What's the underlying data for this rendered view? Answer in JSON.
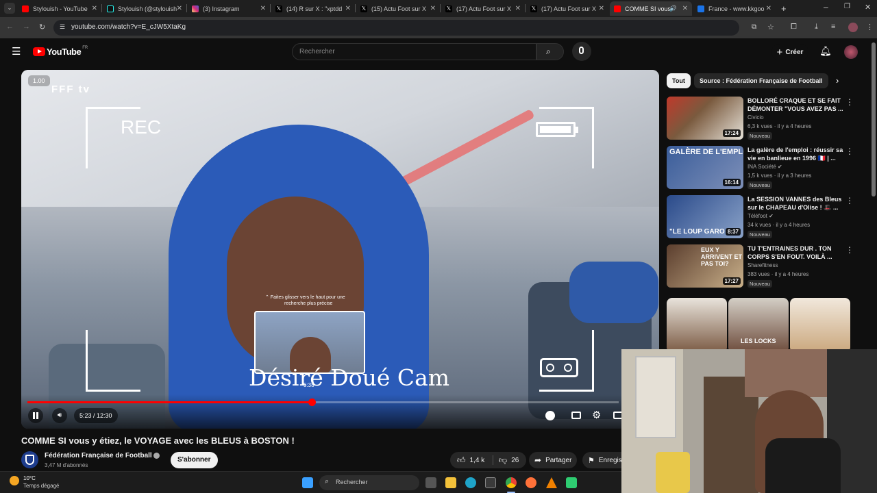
{
  "browser": {
    "tabs": [
      {
        "title": "Stylouish - YouTube",
        "color": "#ff0000"
      },
      {
        "title": "Stylouish (@stylouish",
        "color": "#111111"
      },
      {
        "title": "(3) Instagram",
        "color": "#d62976"
      },
      {
        "title": "(14) R sur X : \"xptdd",
        "color": "#000000"
      },
      {
        "title": "(15) Actu Foot sur X",
        "color": "#000000"
      },
      {
        "title": "(17) Actu Foot sur X",
        "color": "#000000"
      },
      {
        "title": "(17) Actu Foot sur X",
        "color": "#000000"
      },
      {
        "title": "COMME SI vous",
        "color": "#ff0000",
        "active": true
      },
      {
        "title": "France - www.kkgoo",
        "color": "#1a73e8"
      }
    ],
    "new_tab": "+",
    "url": "youtube.com/watch?v=E_cJW5XtaKg"
  },
  "youtube": {
    "logo_text": "YouTube",
    "region": "FR",
    "search_placeholder": "Rechercher",
    "create_label": "Créer"
  },
  "player": {
    "speed_badge": "1.00",
    "watermark": "FFF tv",
    "rec_label": "REC",
    "overlay_title": "Désiré Doué Cam",
    "hint_line1": "⌃ Faites glisser vers le haut pour une",
    "hint_line2": "recherche plus précise",
    "preview_time": "5:38",
    "time_current": "5:23",
    "time_total": "12:30",
    "time_display": "5:23 / 12:30",
    "progress": 0.4813
  },
  "video": {
    "title": "COMME SI vous y étiez, le VOYAGE avec les BLEUS à BOSTON !",
    "channel": "Fédération Française de Football",
    "subscribers": "3,47 M d'abonnés",
    "subscribe_label": "S'abonner",
    "likes": "1,4 k",
    "dislikes": "26",
    "share_label": "Partager",
    "save_label": "Enregis"
  },
  "sidebar": {
    "chips": [
      "Tout",
      "Source : Fédération Française de Football"
    ],
    "recommendations": [
      {
        "title": "BOLLORÉ CRAQUE ET SE FAIT DÉMONTER \"VOUS AVEZ PAS ...",
        "channel": "Civicio",
        "meta": "6,3 k vues · il y a 4 heures",
        "badge": "Nouveau",
        "duration": "17:24",
        "thumb_color": "#7a5a3e"
      },
      {
        "title": "La galère de l'emploi : réussir sa vie en banlieue en 1996 🇫🇷 | ...",
        "channel": "INA Société ✔",
        "meta": "1,5 k vues · il y a 3 heures",
        "badge": "Nouveau",
        "duration": "16:14",
        "thumb_color": "#3a5d9a",
        "thumb_text": "GALÈRE DE L'EMPLOI"
      },
      {
        "title": "La SESSION VANNES des Bleus sur le CHAPEAU d'Olise ! 🎩 ...",
        "channel": "Téléfoot ✔",
        "meta": "34 k vues · il y a 4 heures",
        "badge": "Nouveau",
        "duration": "8:37",
        "thumb_color": "#2a4a8a",
        "thumb_text": "\"LE LOUP GARO"
      },
      {
        "title": "TU T'ENTRAINES DUR . TON CORPS S'EN FOUT. VOILÀ ...",
        "channel": "Sharefitness",
        "meta": "383 vues · il y a 4 heures",
        "badge": "Nouveau",
        "duration": "17:27",
        "thumb_color": "#5b3e2e",
        "thumb_text": "EUX Y ARRIVENT ET PAS TOI?"
      }
    ],
    "shorts": [
      {
        "label": "",
        "color": "#7b5a43"
      },
      {
        "label": "LES LOCKS",
        "color": "#6d4b3b"
      },
      {
        "label": "",
        "color": "#caa77d"
      }
    ]
  },
  "taskbar": {
    "weather_temp": "10°C",
    "weather_desc": "Temps dégagé",
    "search_label": "Rechercher"
  }
}
